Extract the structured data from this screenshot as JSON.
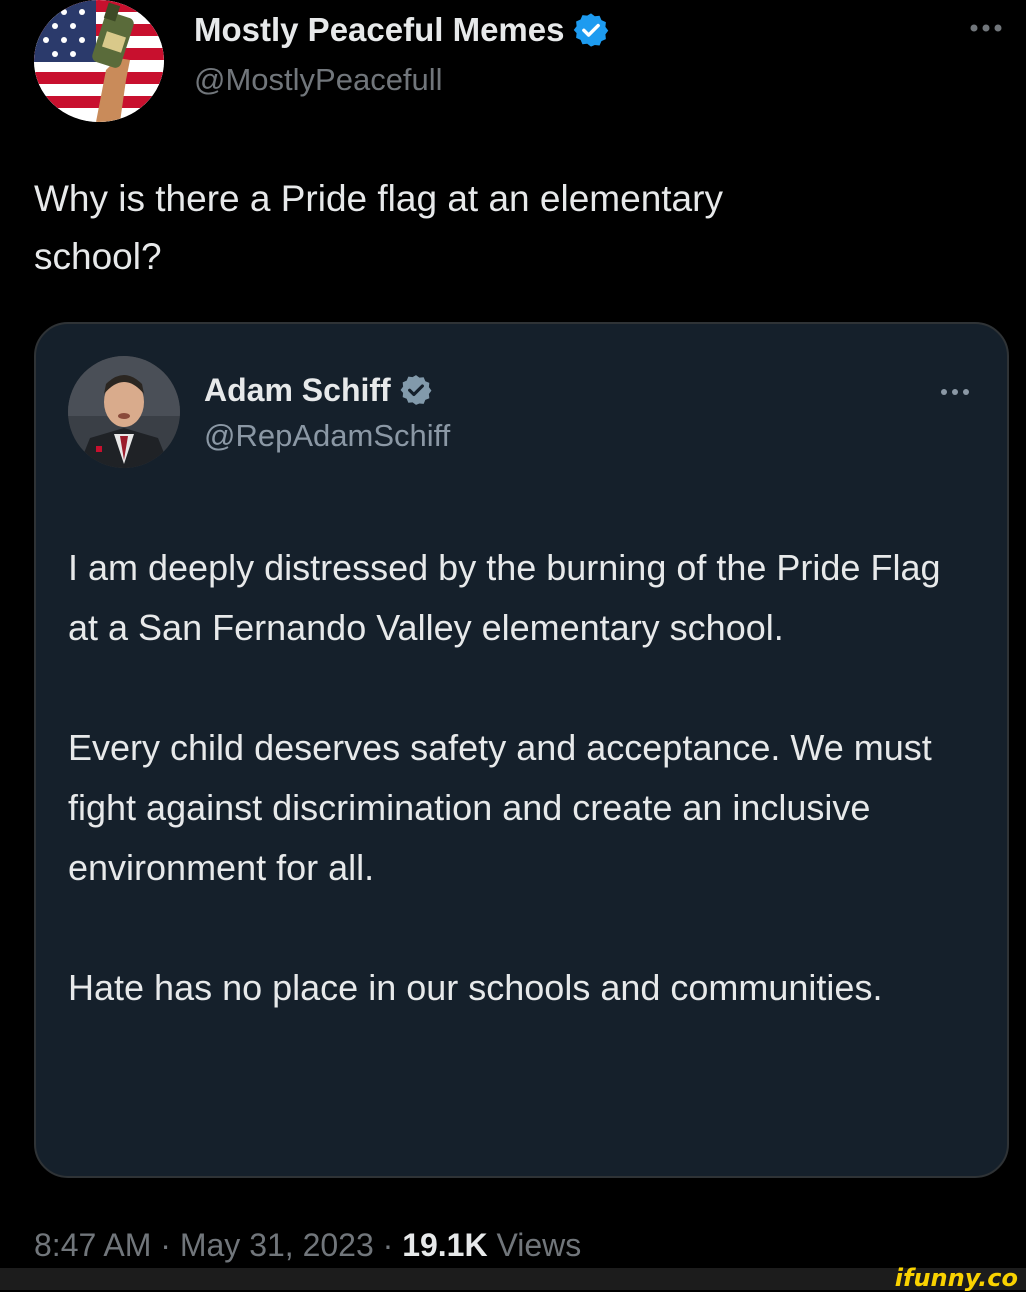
{
  "tweet": {
    "author": {
      "name": "Mostly Peaceful Memes",
      "handle": "@MostlyPeacefull",
      "verified": true
    },
    "text": "Why is there a Pride flag at an elementary\nschool?",
    "quoted_tweet": {
      "author": {
        "name": "Adam Schiff",
        "handle": "@RepAdamSchiff",
        "verified": true
      },
      "paragraphs": [
        "I am deeply distressed by the burning of the Pride Flag at a San Fernando Valley elementary school.",
        "Every child deserves safety and acceptance. We must fight against discrimination and create an inclusive environment for all.",
        "Hate has no place in our schools and communities."
      ]
    },
    "meta": {
      "time": "8:47 AM",
      "separator": "·",
      "date": "May 31, 2023",
      "views_count": "19.1K",
      "views_label": "Views"
    }
  },
  "watermark": {
    "text": "ifunny.co"
  },
  "colors": {
    "background": "#000000",
    "quote_background": "#15202b",
    "text_primary": "#e7e9ea",
    "text_secondary": "#71767b",
    "verified_blue": "#1d9bf0",
    "verified_grey": "#829aab",
    "watermark": "#f9d200"
  },
  "icons": {
    "verified": "verified-badge-icon",
    "more": "more-horizontal-icon"
  }
}
